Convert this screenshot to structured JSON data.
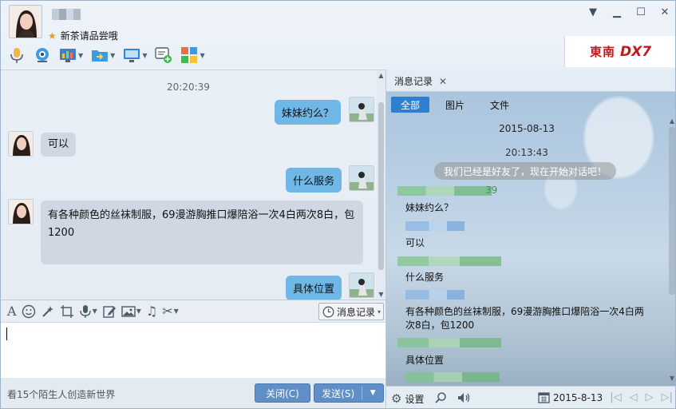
{
  "header": {
    "signature": "新茶请品尝哦"
  },
  "window_controls": {
    "menu_glyph": "▼",
    "minimize_glyph": "▁",
    "maximize_glyph": "☐",
    "close_glyph": "✕"
  },
  "toolbar": {
    "tools": [
      "microphone-icon",
      "camera-icon",
      "app-icon",
      "transfer-icon",
      "screen-icon",
      "invite-icon",
      "apps-icon"
    ]
  },
  "ad": {
    "brand": "東南",
    "model": "DX7"
  },
  "chat": {
    "time": "20:20:39",
    "messages": [
      {
        "side": "out",
        "text": "妹妹约么？"
      },
      {
        "side": "in",
        "text": "可以"
      },
      {
        "side": "out",
        "text": "什么服务"
      },
      {
        "side": "in",
        "text_line1": "有各种颜色的丝袜制服，69漫游胸推口爆陪浴一次4白两次8白，包",
        "text_line2": "1200"
      },
      {
        "side": "out",
        "text": "具体位置"
      }
    ]
  },
  "input_toolbar": {
    "history_label": "消息记录"
  },
  "bottom": {
    "promo": "看15个陌生人创造新世界",
    "close_label": "关闭(C)",
    "send_label": "发送(S)"
  },
  "history_panel": {
    "tab_label": "消息记录",
    "filters": [
      "全部",
      "图片",
      "文件"
    ],
    "date": "2015-08-13",
    "time": "20:13:43",
    "system_message": "我们已经是好友了，现在开始对话吧！",
    "timestamp_fragment": "39",
    "entries": [
      "妹妹约么？",
      "可以",
      "什么服务",
      "有各种颜色的丝袜制服，69漫游胸推口爆陪浴一次4白两",
      "次8白，包1200",
      "具体位置"
    ],
    "settings_label": "设置",
    "footer_date": "2015-8-13"
  },
  "colors": {
    "accent_blue": "#2f7fd1",
    "bubble_out": "#6fb7e6",
    "bubble_in": "#cfd8e2",
    "button": "#5f8fc6",
    "ad_red": "#c8161d"
  }
}
